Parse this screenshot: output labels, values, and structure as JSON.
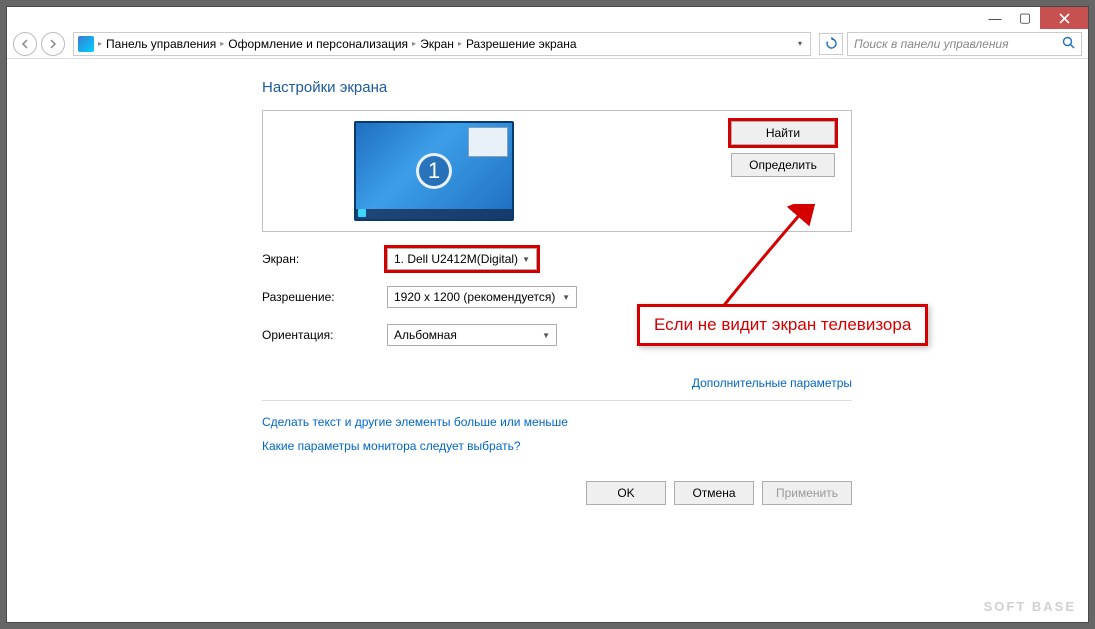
{
  "titlebar": {
    "min": "—",
    "max": "▢"
  },
  "breadcrumb": {
    "items": [
      "Панель управления",
      "Оформление и персонализация",
      "Экран",
      "Разрешение экрана"
    ]
  },
  "search": {
    "placeholder": "Поиск в панели управления"
  },
  "heading": "Настройки экрана",
  "monitor": {
    "number": "1"
  },
  "buttons": {
    "find": "Найти",
    "identify": "Определить",
    "ok": "OK",
    "cancel": "Отмена",
    "apply": "Применить"
  },
  "form": {
    "display_label": "Экран:",
    "display_value": "1. Dell U2412M(Digital)",
    "resolution_label": "Разрешение:",
    "resolution_value": "1920 x 1200 (рекомендуется)",
    "orientation_label": "Ориентация:",
    "orientation_value": "Альбомная"
  },
  "links": {
    "advanced": "Дополнительные параметры",
    "text_size": "Сделать текст и другие элементы больше или меньше",
    "which_settings": "Какие параметры монитора следует выбрать?"
  },
  "callout": "Если не видит экран телевизора",
  "watermark": "SOFT  BASE"
}
